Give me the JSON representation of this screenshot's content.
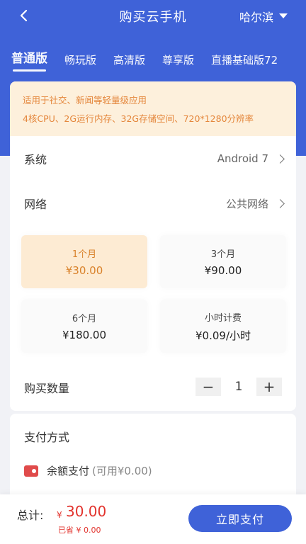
{
  "header": {
    "title": "购买云手机",
    "city": "哈尔滨"
  },
  "tabs": [
    {
      "label": "普通版"
    },
    {
      "label": "畅玩版"
    },
    {
      "label": "高清版"
    },
    {
      "label": "尊享版"
    },
    {
      "label": "直播基础版72"
    }
  ],
  "notice": {
    "line1": "适用于社交、新闻等轻量级应用",
    "line2": "4核CPU、2G运行内存、32G存储空间、720*1280分辨率"
  },
  "system": {
    "label": "系统",
    "value": "Android 7"
  },
  "network": {
    "label": "网络",
    "value": "公共网络"
  },
  "plans": [
    {
      "name": "1个月",
      "price": "¥30.00"
    },
    {
      "name": "3个月",
      "price": "¥90.00"
    },
    {
      "name": "6个月",
      "price": "¥180.00"
    },
    {
      "name": "小时计费",
      "price": "¥0.09/小时"
    }
  ],
  "quantity": {
    "label": "购买数量",
    "value": "1",
    "minus": "−",
    "plus": "+"
  },
  "payment": {
    "title": "支付方式",
    "method": "余额支付",
    "available": "(可用¥0.00)"
  },
  "footer": {
    "total_label": "总计:",
    "currency": "¥",
    "total": "30.00",
    "saved": "已省 ¥ 0.00",
    "pay_button": "立即支付"
  },
  "colors": {
    "brand": "#3f62d8",
    "accent_orange": "#d9822b",
    "price_red": "#e2332d"
  }
}
